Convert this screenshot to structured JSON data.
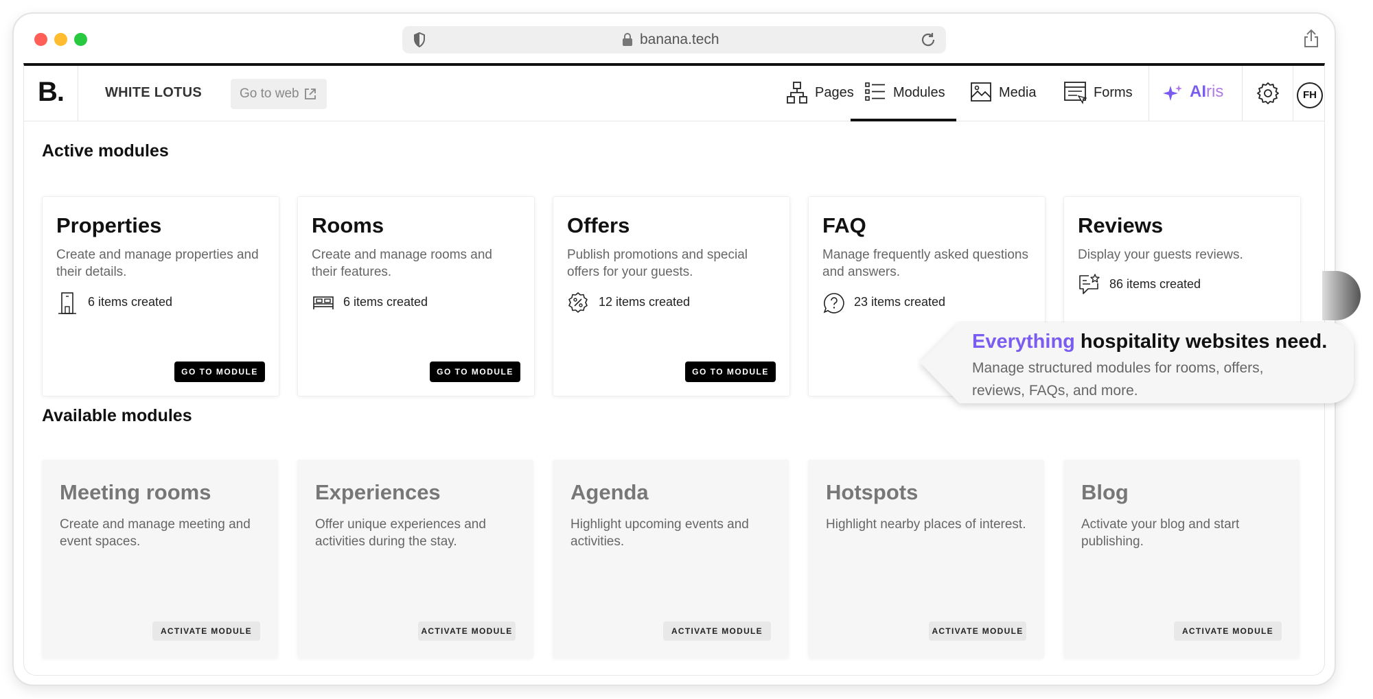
{
  "browser": {
    "url": "banana.tech"
  },
  "header": {
    "logo": "B.",
    "site_name": "WHITE LOTUS",
    "go_to_web": "Go to web",
    "nav": [
      {
        "label": "Pages",
        "icon": "sitemap-icon"
      },
      {
        "label": "Modules",
        "icon": "list-icon",
        "active": true
      },
      {
        "label": "Media",
        "icon": "image-icon"
      },
      {
        "label": "Forms",
        "icon": "form-icon"
      }
    ],
    "airis": {
      "ai": "AI",
      "ris": "ris"
    },
    "settings_icon": "gear-icon",
    "avatar_initials": "FH"
  },
  "active_modules": {
    "title": "Active modules",
    "button_label": "GO TO MODULE",
    "cards": [
      {
        "title": "Properties",
        "description": "Create and manage properties and their details.",
        "count": "6 items created",
        "icon": "building-icon",
        "has_button": true
      },
      {
        "title": "Rooms",
        "description": "Create and manage rooms and their features.",
        "count": "6 items created",
        "icon": "bed-icon",
        "has_button": true
      },
      {
        "title": "Offers",
        "description": "Publish promotions and special offers for your guests.",
        "count": "12 items created",
        "icon": "discount-badge-icon",
        "has_button": true
      },
      {
        "title": "FAQ",
        "description": "Manage frequently asked questions and answers.",
        "count": "23 items created",
        "icon": "question-bubble-icon",
        "has_button": false
      },
      {
        "title": "Reviews",
        "description": "Display your guests reviews.",
        "count": "86 items created",
        "icon": "review-star-icon",
        "has_button": false
      }
    ]
  },
  "available_modules": {
    "title": "Available modules",
    "button_label": "ACTIVATE MODULE",
    "cards": [
      {
        "title": "Meeting rooms",
        "description": "Create and manage meeting and event spaces."
      },
      {
        "title": "Experiences",
        "description": "Offer unique experiences and activities during the stay."
      },
      {
        "title": "Agenda",
        "description": "Highlight upcoming events and activities."
      },
      {
        "title": "Hotspots",
        "description": "Highlight nearby places of interest."
      },
      {
        "title": "Blog",
        "description": "Activate your blog and start publishing."
      }
    ]
  },
  "callout": {
    "highlight": "Everything",
    "headline_rest": " hospitality websites need.",
    "body": "Manage structured modules for rooms, offers, reviews, FAQs, and more."
  },
  "colors": {
    "accent": "#7b5cf0",
    "accent_light": "#b07ae6",
    "primary_button": "#000000"
  }
}
